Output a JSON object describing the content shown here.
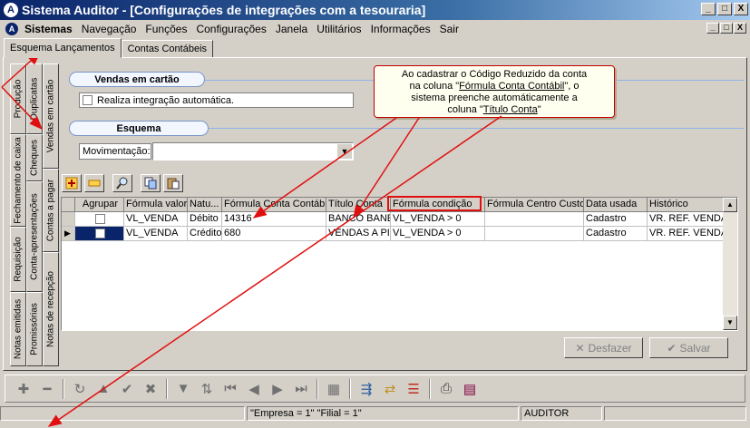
{
  "window": {
    "title": "Sistema Auditor - [Configurações de integrações com a tesouraria]",
    "app_icon": "A",
    "buttons": [
      "_",
      "□",
      "X"
    ]
  },
  "menu": {
    "app_icon": "A",
    "items": [
      "Sistemas",
      "Navegação",
      "Funções",
      "Configurações",
      "Janela",
      "Utilitários",
      "Informações",
      "Sair"
    ],
    "mdi_buttons": [
      "_",
      "□",
      "X"
    ]
  },
  "tabs": [
    {
      "label": "Esquema Lançamentos",
      "active": true
    },
    {
      "label": "Contas Contábeis",
      "active": false
    }
  ],
  "vtabs_left": [
    "Produção",
    "Fechamento de caixa",
    "Requisição",
    "Notas emitidas"
  ],
  "vtabs_mid": [
    "Duplicatas",
    "Cheques",
    "Conta-apresentações",
    "Promissórias"
  ],
  "vtabs_right": [
    "Vendas em cartão",
    "Contas a pagar",
    "Notas de recepção"
  ],
  "sections": {
    "vendas": "Vendas em cartão",
    "esquema": "Esquema"
  },
  "checkbox": {
    "label": "Realiza integração automática."
  },
  "movimentacao": {
    "label": "Movimentação:",
    "value": ""
  },
  "callout": {
    "line1": "Ao cadastrar o Código Reduzido  da conta",
    "line2a": "na coluna \"",
    "line2b": "Fórmula Conta Contábil",
    "line2c": "\", o",
    "line3": "sistema preenche automáticamente a",
    "line4a": "coluna \"",
    "line4b": "Título Conta",
    "line4c": "\""
  },
  "grid": {
    "columns": [
      "Agrupar",
      "Fórmula valor",
      "Natu...",
      "Fórmula Conta Contábil",
      "Título Conta",
      "Fórmula condição",
      "Fórmula Centro Custo",
      "Data usada",
      "Histórico"
    ],
    "rows": [
      {
        "agrupar": "",
        "formula_valor": "VL_VENDA",
        "natureza": "Débito",
        "conta": "14316",
        "titulo": "BANCO BANE",
        "condicao": "VL_VENDA > 0",
        "centro": "",
        "data": "Cadastro",
        "historico": "VR. REF. VENDA"
      },
      {
        "agrupar": "",
        "formula_valor": "VL_VENDA",
        "natureza": "Crédito",
        "conta": "680",
        "titulo": "VENDAS A PI",
        "condicao": "VL_VENDA > 0",
        "centro": "",
        "data": "Cadastro",
        "historico": "VR. REF. VENDA"
      }
    ]
  },
  "buttons": {
    "desfazer": "Desfazer",
    "salvar": "Salvar"
  },
  "status": {
    "p1": "",
    "p2": "\"Empresa = 1\"   \"Filial = 1\"",
    "p3": "",
    "p4": "AUDITOR",
    "p5": ""
  }
}
